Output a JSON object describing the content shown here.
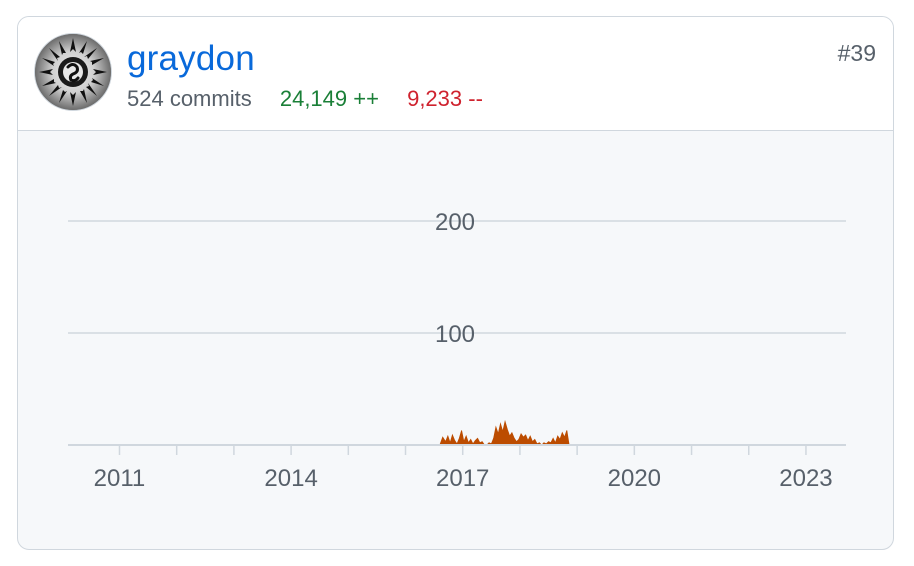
{
  "contributor": {
    "username": "graydon",
    "commits_text": "524 commits",
    "additions_text": "24,149 ++",
    "deletions_text": "9,233 --",
    "rank": "#39",
    "avatar_icon": "avatar-image-icon"
  },
  "colors": {
    "link": "#0969da",
    "additions": "#1a7f37",
    "deletions": "#cf222e",
    "area": "#bc4c00",
    "grid": "#d0d7de",
    "axis_text": "#57606a"
  },
  "chart_data": {
    "type": "area",
    "title": "",
    "xlabel": "",
    "ylabel": "",
    "xlim": [
      2010.1,
      2023.7
    ],
    "ylim": [
      0,
      200
    ],
    "y_ticks": [
      100,
      200
    ],
    "y_tick_labels": [
      "100",
      "200"
    ],
    "x_tick_labels": [
      {
        "label": "2011",
        "x": 2011
      },
      {
        "label": "2014",
        "x": 2014
      },
      {
        "label": "2017",
        "x": 2017
      },
      {
        "label": "2020",
        "x": 2020
      },
      {
        "label": "2023",
        "x": 2023
      }
    ],
    "x_minor_ticks": [
      2011,
      2012,
      2013,
      2014,
      2015,
      2016,
      2017,
      2018,
      2019,
      2020,
      2021,
      2022,
      2023
    ],
    "grid": true,
    "series": [
      {
        "x": [
          2016.6,
          2016.65,
          2016.7,
          2016.74,
          2016.78,
          2016.82,
          2016.86,
          2016.9,
          2016.94,
          2016.98,
          2017.02,
          2017.06,
          2017.1,
          2017.14,
          2017.18,
          2017.22,
          2017.26,
          2017.3,
          2017.34,
          2017.38,
          2017.42,
          2017.46,
          2017.5,
          2017.54,
          2017.58,
          2017.62,
          2017.66,
          2017.7,
          2017.74,
          2017.78,
          2017.82,
          2017.86,
          2017.9,
          2017.94,
          2017.98,
          2018.02,
          2018.06,
          2018.1,
          2018.14,
          2018.18,
          2018.22,
          2018.26,
          2018.3,
          2018.34,
          2018.38,
          2018.42,
          2018.46,
          2018.5,
          2018.54,
          2018.58,
          2018.62,
          2018.66,
          2018.7,
          2018.74,
          2018.78,
          2018.82,
          2018.86
        ],
        "y": [
          0,
          7,
          3,
          8,
          2,
          9,
          4,
          1,
          6,
          13,
          3,
          8,
          2,
          5,
          1,
          4,
          6,
          2,
          3,
          0,
          0,
          2,
          1,
          6,
          16,
          10,
          19,
          12,
          21,
          14,
          8,
          11,
          6,
          3,
          5,
          10,
          7,
          9,
          4,
          8,
          3,
          5,
          1,
          2,
          0,
          2,
          1,
          3,
          2,
          6,
          2,
          8,
          5,
          11,
          7,
          13,
          0
        ]
      }
    ]
  }
}
